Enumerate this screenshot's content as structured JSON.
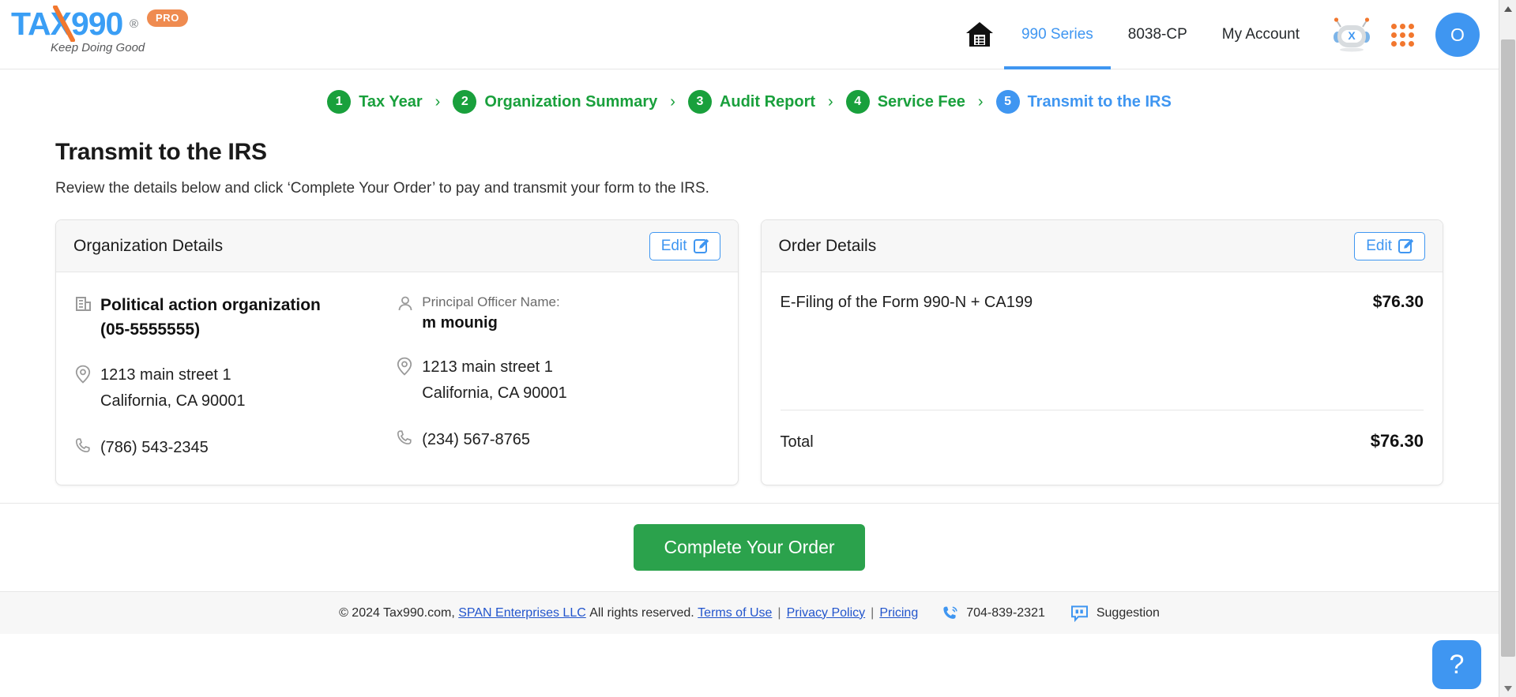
{
  "brand": {
    "logo_text": "TAX990",
    "logo_registered": "®",
    "logo_badge": "PRO",
    "logo_tagline": "Keep Doing Good",
    "accent_blue": "#3f96f1",
    "accent_orange": "#f2772e",
    "accent_green": "#19a03c"
  },
  "header": {
    "home_icon": "home-building-icon",
    "nav": [
      {
        "label": "990 Series",
        "active": true
      },
      {
        "label": "8038-CP",
        "active": false
      },
      {
        "label": "My Account",
        "active": false
      }
    ],
    "bot_icon": "chat-bot-icon",
    "apps_icon": "apps-grid-icon",
    "avatar_initial": "O"
  },
  "stepper": {
    "steps": [
      {
        "number": "1",
        "label": "Tax Year",
        "state": "done"
      },
      {
        "number": "2",
        "label": "Organization Summary",
        "state": "done"
      },
      {
        "number": "3",
        "label": "Audit Report",
        "state": "done"
      },
      {
        "number": "4",
        "label": "Service Fee",
        "state": "done"
      },
      {
        "number": "5",
        "label": "Transmit to the IRS",
        "state": "current"
      }
    ],
    "separator": "›"
  },
  "main": {
    "title": "Transmit to the IRS",
    "subtitle": "Review the details below and click ‘Complete Your Order’ to pay and transmit your form to the IRS."
  },
  "organization_card": {
    "title": "Organization Details",
    "edit_label": "Edit",
    "edit_icon": "pencil-square-icon",
    "building_icon": "building-icon",
    "person_icon": "person-icon",
    "location_icon": "map-pin-icon",
    "phone_icon": "phone-icon",
    "org_name": "Political action organization",
    "org_ein": "(05-5555555)",
    "org_address_line1": "1213 main street 1",
    "org_address_line2": "California, CA 90001",
    "org_phone": "(786) 543-2345",
    "officer_label": "Principal Officer Name:",
    "officer_name": "m mounig",
    "officer_address_line1": "1213 main street 1",
    "officer_address_line2": "California, CA 90001",
    "officer_phone": "(234) 567-8765"
  },
  "order_card": {
    "title": "Order Details",
    "edit_label": "Edit",
    "edit_icon": "pencil-square-icon",
    "line_items": [
      {
        "description": "E-Filing of the Form 990-N + CA199",
        "amount": "$76.30"
      }
    ],
    "total_label": "Total",
    "total_amount": "$76.30"
  },
  "action": {
    "cta_label": "Complete Your Order",
    "cta_color": "#2ba24c"
  },
  "footer": {
    "copyright_prefix": "© 2024 Tax990.com,",
    "company_link": "SPAN Enterprises LLC",
    "rights": "All rights reserved.",
    "links": [
      {
        "label": "Terms of Use"
      },
      {
        "label": "Privacy Policy"
      },
      {
        "label": "Pricing"
      }
    ],
    "separator": "|",
    "phone_icon": "phone-ring-icon",
    "phone": "704-839-2321",
    "suggestion_icon": "quote-bubble-icon",
    "suggestion_label": "Suggestion"
  },
  "help": {
    "label": "?",
    "icon": "question-mark-icon"
  }
}
